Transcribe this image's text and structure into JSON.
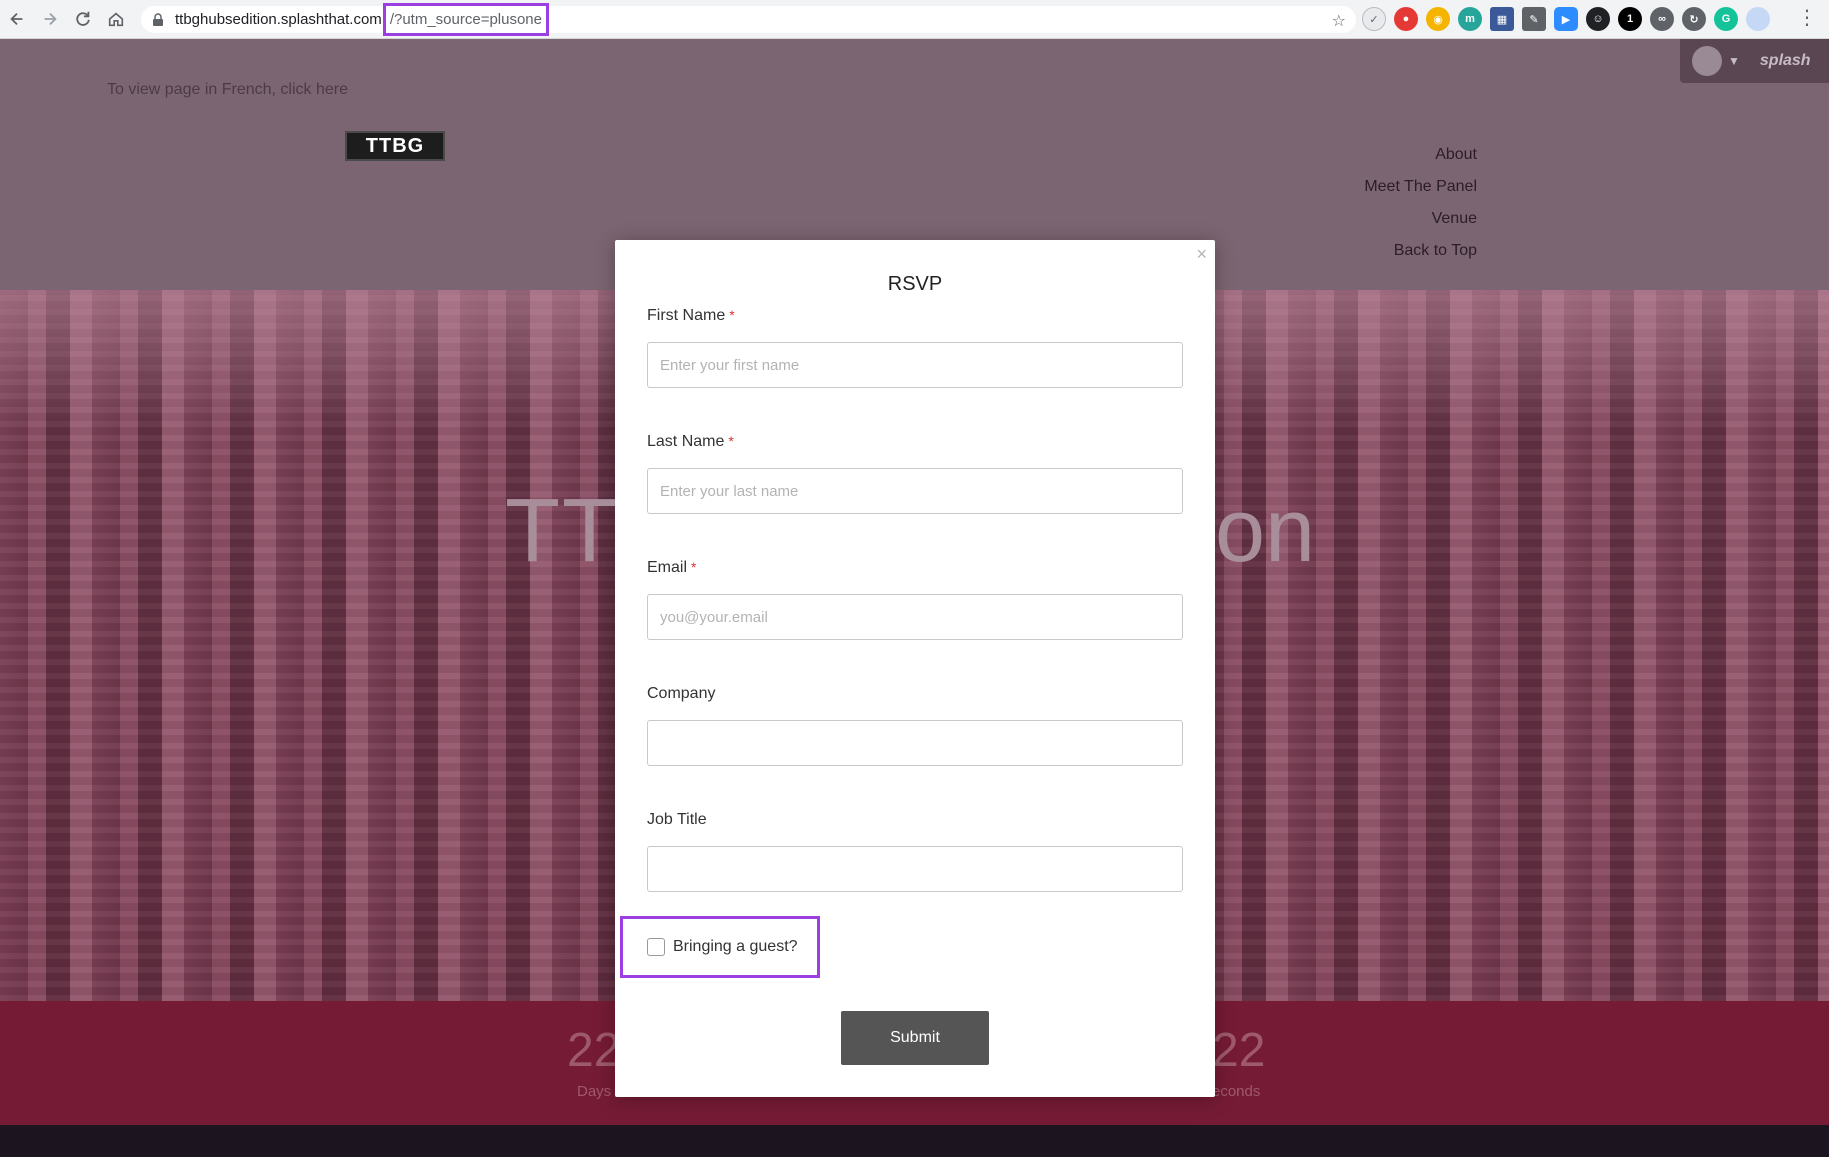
{
  "browser": {
    "url_host": "ttbghubsedition.splashthat.com",
    "url_query": "/?utm_source=plusone"
  },
  "page": {
    "french_link": "To view page in French, click here",
    "logo_text": "TTBG",
    "nav": [
      "About",
      "Meet The Panel",
      "Venue",
      "Back to Top"
    ],
    "splash_brand": "splash",
    "hero_title_start": "TT",
    "hero_title_end": "on"
  },
  "countdown": {
    "left_value": "22",
    "left_label": "Days",
    "right_value": "22",
    "right_label": "econds"
  },
  "modal": {
    "title": "RSVP",
    "close": "×",
    "fields": [
      {
        "label": "First Name",
        "required": "*",
        "placeholder": "Enter your first name",
        "value": ""
      },
      {
        "label": "Last Name",
        "required": "*",
        "placeholder": "Enter your last name",
        "value": ""
      },
      {
        "label": "Email",
        "required": "*",
        "placeholder": "you@your.email",
        "value": ""
      },
      {
        "label": "Company",
        "required": "",
        "placeholder": "",
        "value": ""
      },
      {
        "label": "Job Title",
        "required": "",
        "placeholder": "",
        "value": ""
      }
    ],
    "guest_label": "Bringing a guest?",
    "submit_label": "Submit"
  },
  "colors": {
    "highlight": "#9b3fe2",
    "countdown_band": "#761b35",
    "submit_button": "#555555"
  }
}
